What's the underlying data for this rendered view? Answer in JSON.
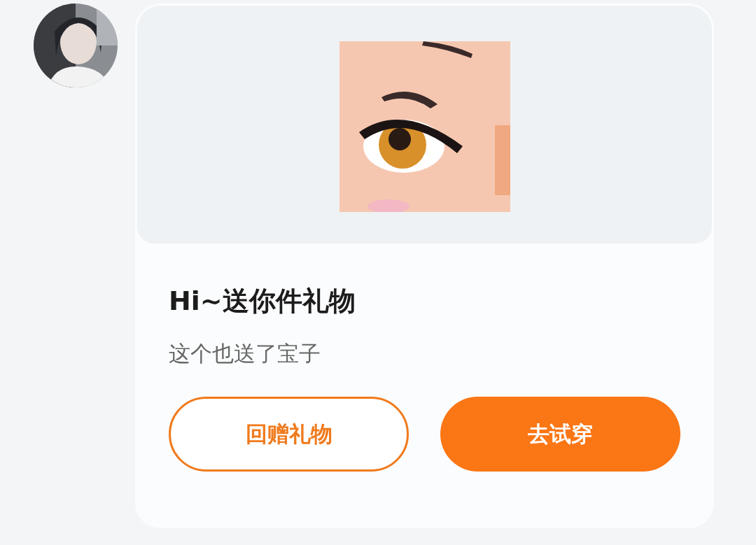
{
  "message": {
    "card": {
      "title": "Hi~送你件礼物",
      "subtitle": "这个也送了宝子",
      "buttons": [
        {
          "label": "回赠礼物",
          "kind": "outline"
        },
        {
          "label": "去试穿",
          "kind": "primary"
        }
      ]
    }
  }
}
